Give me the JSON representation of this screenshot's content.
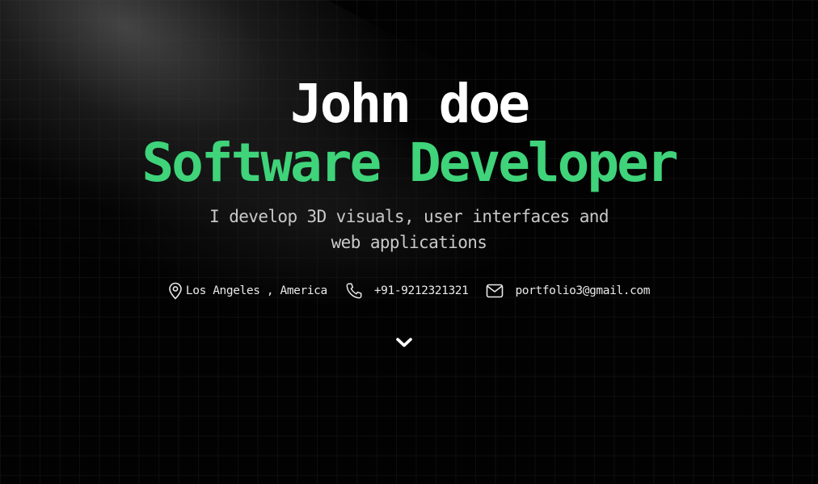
{
  "hero": {
    "name": "John doe",
    "role": "Software Developer",
    "tagline_line1": "I develop 3D visuals, user interfaces and",
    "tagline_line2": "web applications"
  },
  "contacts": {
    "location": "Los Angeles , America",
    "phone": "+91-9212321321",
    "email": "portfolio3@gmail.com"
  },
  "icons": {
    "location": "map-pin-icon",
    "phone": "phone-icon",
    "email": "mail-icon",
    "scroll": "chevron-down-icon"
  },
  "colors": {
    "background": "#020202",
    "name": "#ffffff",
    "accent": "#3fd37a",
    "tagline": "#c9c9c9",
    "contact_text": "#e9e9e9"
  }
}
